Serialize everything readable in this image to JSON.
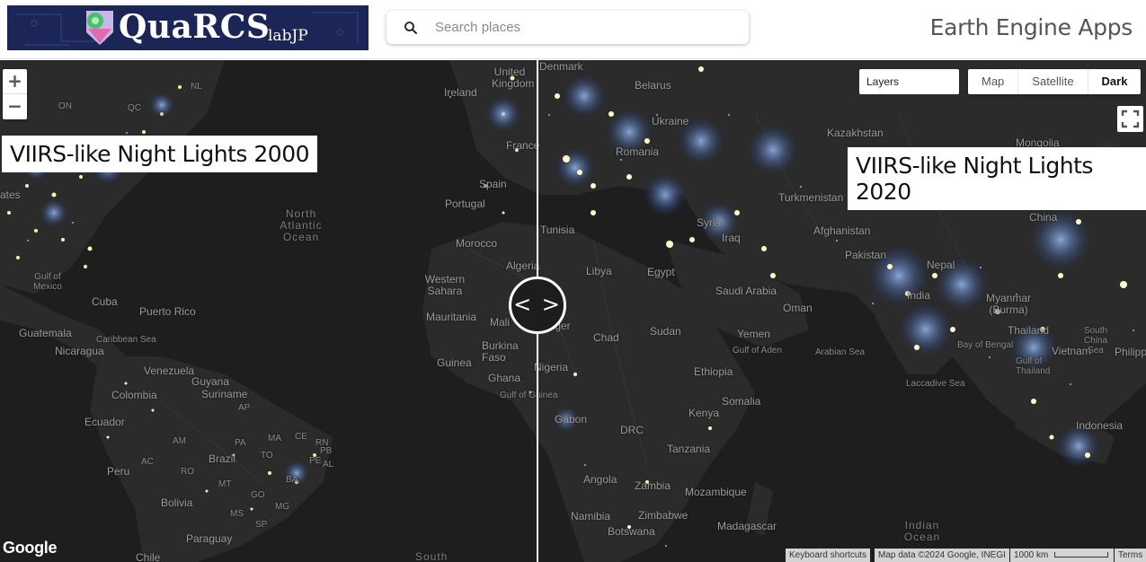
{
  "header": {
    "logo_text": "QuaRCS",
    "logo_sub": "labJP",
    "search_placeholder": "Search places",
    "app_title": "Earth Engine Apps"
  },
  "map": {
    "left_layer_label": "VIIRS-like Night Lights 2000",
    "right_layer_label": "VIIRS-like Night Lights 2020",
    "layers_select_value": "Layers",
    "map_types": [
      "Map",
      "Satellite",
      "Dark"
    ],
    "selected_map_type": "Dark",
    "zoom_in": "+",
    "zoom_out": "−",
    "slider_glyph": "< >",
    "google_logo": "Google",
    "attribution": {
      "keyboard": "Keyboard shortcuts",
      "data": "Map data ©2024 Google, INEGI",
      "scale": "1000 km",
      "terms": "Terms"
    },
    "place_labels": [
      "United Kingdom",
      "Denmark",
      "Belarus",
      "Ireland",
      "Ukraine",
      "Kazakhstan",
      "Mongolia",
      "France",
      "Romania",
      "Spain",
      "Portugal",
      "Turkmenistan",
      "Syria",
      "Iraq",
      "Afghanistan",
      "China",
      "Tunisia",
      "Morocco",
      "Algeria",
      "Libya",
      "Egypt",
      "Pakistan",
      "Nepal",
      "Western Sahara",
      "Saudi Arabia",
      "India",
      "Myanmar (Burma)",
      "Oman",
      "Mauritania",
      "Mali",
      "Niger",
      "Chad",
      "Sudan",
      "Yemen",
      "Thailand",
      "Burkina Faso",
      "Guinea",
      "Nigeria",
      "Ethiopia",
      "Vietnam",
      "Ghana",
      "Gulf of Guinea",
      "Somalia",
      "Gabon",
      "Kenya",
      "DRC",
      "Tanzania",
      "Indonesia",
      "Angola",
      "Zambia",
      "Mozambique",
      "Namibia",
      "Zimbabwe",
      "Madagascar",
      "Botswana",
      "Cuba",
      "Puerto Rico",
      "Guatemala",
      "Caribbean Sea",
      "Nicaragua",
      "Venezuela",
      "Guyana",
      "Suriname",
      "Colombia",
      "Ecuador",
      "Brazil",
      "Peru",
      "Bolivia",
      "Paraguay",
      "Chile",
      "Gulf of Aden",
      "Arabian Sea",
      "Bay of Bengal",
      "Laccadive Sea",
      "Gulf of Thailand",
      "South China Sea",
      "Philippines",
      "Gulf of Mexico",
      "North Atlantic Ocean",
      "Indian Ocean",
      "South",
      "NL",
      "ON",
      "QC",
      "AP",
      "AM",
      "PA",
      "MA",
      "CE",
      "RN",
      "PB",
      "AC",
      "RO",
      "TO",
      "PE",
      "AL",
      "MT",
      "BA",
      "GO",
      "MG",
      "MS",
      "SP",
      "ates"
    ]
  }
}
